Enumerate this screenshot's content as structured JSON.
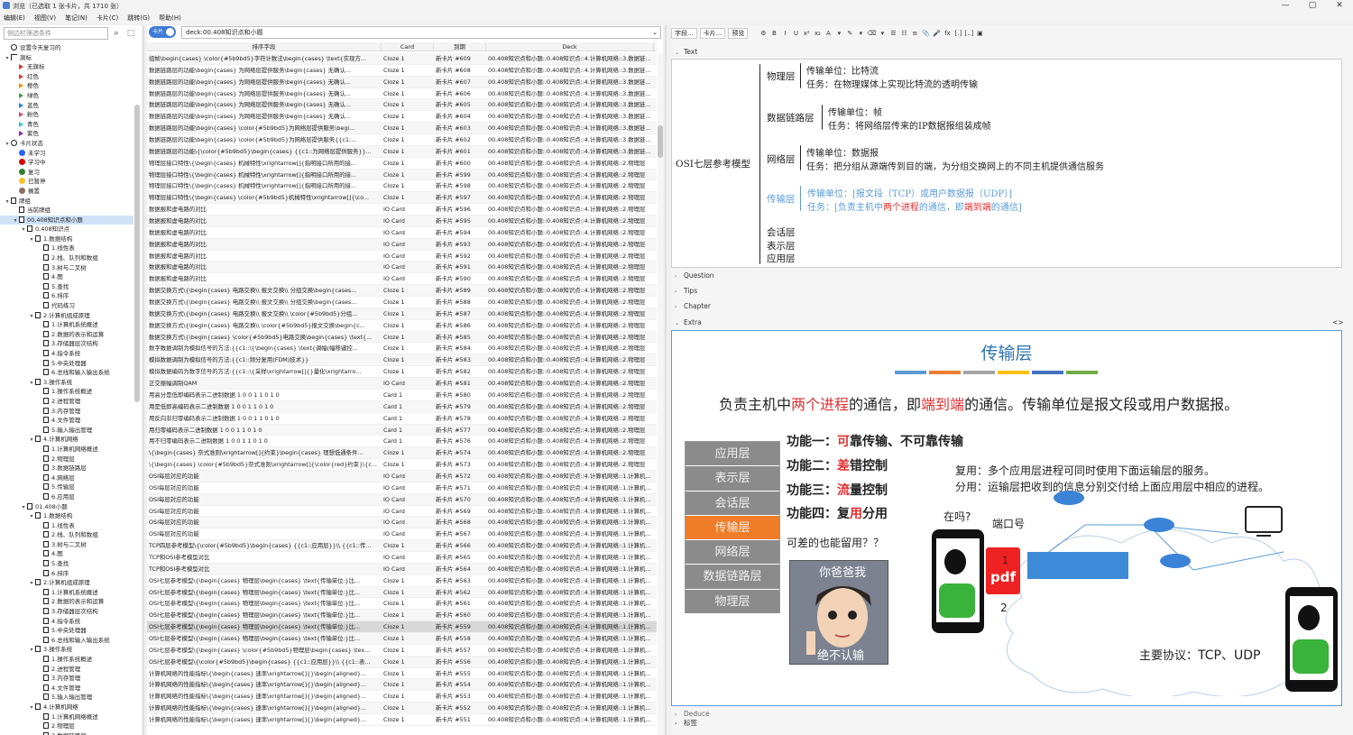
{
  "window": {
    "title": "浏览（已选取 1 张卡片，共 1710 张）",
    "controls": [
      "—",
      "▢",
      "✕"
    ]
  },
  "menu": [
    "编辑(E)",
    "视图(V)",
    "笔记(N)",
    "卡片(C)",
    "跳转(G)",
    "帮助(H)"
  ],
  "sidebar": {
    "search_placeholder": "侧边栏筛选条件",
    "items": [
      {
        "d": 0,
        "a": "",
        "i": "clock",
        "t": "设置今天复习的"
      },
      {
        "d": 0,
        "a": "▾",
        "i": "flag0",
        "t": "旗标"
      },
      {
        "d": 1,
        "a": "",
        "i": "flag",
        "c": "#d33",
        "t": "无旗标"
      },
      {
        "d": 1,
        "a": "",
        "i": "flag",
        "c": "#e53935",
        "t": "红色"
      },
      {
        "d": 1,
        "a": "",
        "i": "flag",
        "c": "#fb8c00",
        "t": "橙色"
      },
      {
        "d": 1,
        "a": "",
        "i": "flag",
        "c": "#43a047",
        "t": "绿色"
      },
      {
        "d": 1,
        "a": "",
        "i": "flag",
        "c": "#1e88e5",
        "t": "蓝色"
      },
      {
        "d": 1,
        "a": "",
        "i": "flag",
        "c": "#ec407a",
        "t": "粉色"
      },
      {
        "d": 1,
        "a": "",
        "i": "flag",
        "c": "#26c6da",
        "t": "青色"
      },
      {
        "d": 1,
        "a": "",
        "i": "flag",
        "c": "#8e24aa",
        "t": "紫色"
      },
      {
        "d": 0,
        "a": "▾",
        "i": "circle",
        "t": "卡片状态"
      },
      {
        "d": 1,
        "a": "",
        "i": "dot",
        "c": "#2962ff",
        "t": "未学习"
      },
      {
        "d": 1,
        "a": "",
        "i": "dot",
        "c": "#d50000",
        "t": "学习中"
      },
      {
        "d": 1,
        "a": "",
        "i": "dot",
        "c": "#2e7d32",
        "t": "复习"
      },
      {
        "d": 1,
        "a": "",
        "i": "dot",
        "c": "#fbc02d",
        "t": "已暂停"
      },
      {
        "d": 1,
        "a": "",
        "i": "dot",
        "c": "#8d6e63",
        "t": "搁置"
      },
      {
        "d": 0,
        "a": "▾",
        "i": "deck",
        "t": "牌组"
      },
      {
        "d": 1,
        "a": "",
        "i": "deck",
        "t": "当前牌组"
      },
      {
        "d": 1,
        "a": "▾",
        "i": "deck",
        "t": "00.408知识点和小题",
        "sel": true
      },
      {
        "d": 2,
        "a": "▾",
        "i": "deck",
        "t": "0.408知识点"
      },
      {
        "d": 3,
        "a": "▾",
        "i": "deck",
        "t": "1.数据结构"
      },
      {
        "d": 4,
        "a": "",
        "i": "deck",
        "t": "1.线性表"
      },
      {
        "d": 4,
        "a": "",
        "i": "deck",
        "t": "2.栈、队列和数组"
      },
      {
        "d": 4,
        "a": "",
        "i": "deck",
        "t": "3.树与二叉树"
      },
      {
        "d": 4,
        "a": "",
        "i": "deck",
        "t": "4.图"
      },
      {
        "d": 4,
        "a": "",
        "i": "deck",
        "t": "5.查找"
      },
      {
        "d": 4,
        "a": "",
        "i": "deck",
        "t": "6.排序"
      },
      {
        "d": 4,
        "a": "",
        "i": "deck",
        "t": "代码练习"
      },
      {
        "d": 3,
        "a": "▾",
        "i": "deck",
        "t": "2.计算机组成原理"
      },
      {
        "d": 4,
        "a": "",
        "i": "deck",
        "t": "1.计算机系统概述"
      },
      {
        "d": 4,
        "a": "",
        "i": "deck",
        "t": "2.数据的表示和运算"
      },
      {
        "d": 4,
        "a": "",
        "i": "deck",
        "t": "3.存储器层次结构"
      },
      {
        "d": 4,
        "a": "",
        "i": "deck",
        "t": "4.指令系统"
      },
      {
        "d": 4,
        "a": "",
        "i": "deck",
        "t": "5.中央处理器"
      },
      {
        "d": 4,
        "a": "",
        "i": "deck",
        "t": "6.总线和输入输出系统"
      },
      {
        "d": 3,
        "a": "▾",
        "i": "deck",
        "t": "3.操作系统"
      },
      {
        "d": 4,
        "a": "",
        "i": "deck",
        "t": "1.操作系统概述"
      },
      {
        "d": 4,
        "a": "",
        "i": "deck",
        "t": "2.进程管理"
      },
      {
        "d": 4,
        "a": "",
        "i": "deck",
        "t": "3.内存管理"
      },
      {
        "d": 4,
        "a": "",
        "i": "deck",
        "t": "4.文件管理"
      },
      {
        "d": 4,
        "a": "",
        "i": "deck",
        "t": "5.输入输出管理"
      },
      {
        "d": 3,
        "a": "▾",
        "i": "deck",
        "t": "4.计算机网络"
      },
      {
        "d": 4,
        "a": "",
        "i": "deck",
        "t": "1.计算机网络概述"
      },
      {
        "d": 4,
        "a": "",
        "i": "deck",
        "t": "2.物理层"
      },
      {
        "d": 4,
        "a": "",
        "i": "deck",
        "t": "3.数据链路层"
      },
      {
        "d": 4,
        "a": "",
        "i": "deck",
        "t": "4.网络层"
      },
      {
        "d": 4,
        "a": "",
        "i": "deck",
        "t": "5.传输层"
      },
      {
        "d": 4,
        "a": "",
        "i": "deck",
        "t": "6.应用层"
      },
      {
        "d": 2,
        "a": "▾",
        "i": "deck",
        "t": "01.408小题"
      },
      {
        "d": 3,
        "a": "▾",
        "i": "deck",
        "t": "1.数据结构"
      },
      {
        "d": 4,
        "a": "",
        "i": "deck",
        "t": "1.线性表"
      },
      {
        "d": 4,
        "a": "",
        "i": "deck",
        "t": "2.栈、队列和数组"
      },
      {
        "d": 4,
        "a": "",
        "i": "deck",
        "t": "3.树与二叉树"
      },
      {
        "d": 4,
        "a": "",
        "i": "deck",
        "t": "4.图"
      },
      {
        "d": 4,
        "a": "",
        "i": "deck",
        "t": "5.查找"
      },
      {
        "d": 4,
        "a": "",
        "i": "deck",
        "t": "6.排序"
      },
      {
        "d": 3,
        "a": "▾",
        "i": "deck",
        "t": "2.计算机组成原理"
      },
      {
        "d": 4,
        "a": "",
        "i": "deck",
        "t": "1.计算机系统概述"
      },
      {
        "d": 4,
        "a": "",
        "i": "deck",
        "t": "2.数据的表示和运算"
      },
      {
        "d": 4,
        "a": "",
        "i": "deck",
        "t": "3.存储器层次结构"
      },
      {
        "d": 4,
        "a": "",
        "i": "deck",
        "t": "4.指令系统"
      },
      {
        "d": 4,
        "a": "",
        "i": "deck",
        "t": "5.中央处理器"
      },
      {
        "d": 4,
        "a": "",
        "i": "deck",
        "t": "6.总线和输入输出系统"
      },
      {
        "d": 3,
        "a": "▾",
        "i": "deck",
        "t": "3.操作系统"
      },
      {
        "d": 4,
        "a": "",
        "i": "deck",
        "t": "1.操作系统概述"
      },
      {
        "d": 4,
        "a": "",
        "i": "deck",
        "t": "2.进程管理"
      },
      {
        "d": 4,
        "a": "",
        "i": "deck",
        "t": "3.内存管理"
      },
      {
        "d": 4,
        "a": "",
        "i": "deck",
        "t": "4.文件管理"
      },
      {
        "d": 4,
        "a": "",
        "i": "deck",
        "t": "5.输入输出管理"
      },
      {
        "d": 3,
        "a": "▾",
        "i": "deck",
        "t": "4.计算机网络"
      },
      {
        "d": 4,
        "a": "",
        "i": "deck",
        "t": "1.计算机网络概述"
      },
      {
        "d": 4,
        "a": "",
        "i": "deck",
        "t": "2.物理层"
      },
      {
        "d": 4,
        "a": "",
        "i": "deck",
        "t": "3.数据链路层"
      }
    ]
  },
  "browser": {
    "toggle_label": "卡片",
    "search_value": "deck:00.408知识点和小题",
    "columns": [
      "排序字段",
      "Card",
      "到期",
      "Deck"
    ],
    "selected_index": 49,
    "rows": [
      [
        "组帧\\begin{cases} \\color{#5b9bd5}字符计数法\\begin{cases} \\text{实现方...",
        "Cloze 1",
        "新卡片 #609",
        "00.408知识点和小题::0.408知识点::4.计算机网络::3.数据链..."
      ],
      [
        "数据链路层的功能\\begin{cases} 为网络层提供服务\\begin{cases} 无确认...",
        "Cloze 1",
        "新卡片 #608",
        "00.408知识点和小题::0.408知识点::4.计算机网络::3.数据链..."
      ],
      [
        "数据链路层的功能\\begin{cases} 为网络层提供服务\\begin{cases} 无确认...",
        "Cloze 1",
        "新卡片 #607",
        "00.408知识点和小题::0.408知识点::4.计算机网络::3.数据链..."
      ],
      [
        "数据链路层的功能\\begin{cases} 为网络层提供服务\\begin{cases} 无确认...",
        "Cloze 1",
        "新卡片 #606",
        "00.408知识点和小题::0.408知识点::4.计算机网络::3.数据链..."
      ],
      [
        "数据链路层的功能\\begin{cases} 为网络层提供服务\\begin{cases} 无确认...",
        "Cloze 1",
        "新卡片 #605",
        "00.408知识点和小题::0.408知识点::4.计算机网络::3.数据链..."
      ],
      [
        "数据链路层的功能\\begin{cases} 为网络层提供服务\\begin{cases} 无确认...",
        "Cloze 1",
        "新卡片 #604",
        "00.408知识点和小题::0.408知识点::4.计算机网络::3.数据链..."
      ],
      [
        "数据链路层的功能\\begin{cases} \\color{#5b9bd5}为网络层提供服务\\begi...",
        "Cloze 1",
        "新卡片 #603",
        "00.408知识点和小题::0.408知识点::4.计算机网络::3.数据链..."
      ],
      [
        "数据链路层的功能\\begin{cases} \\color{#5b9bd5}为网络层提供服务{{c1:...",
        "Cloze 1",
        "新卡片 #602",
        "00.408知识点和小题::0.408知识点::4.计算机网络::3.数据链..."
      ],
      [
        "数据链路层的功能\\{\\color{#5b9bd5}\\begin{cases} {{c1::为网络层提供服务}}...",
        "Cloze 1",
        "新卡片 #601",
        "00.408知识点和小题::0.408知识点::4.计算机网络::3.数据链..."
      ],
      [
        "物理层接口特性\\{\\begin{cases} 机械特性\\xrightarrow[]{指明接口所用的接...",
        "Cloze 1",
        "新卡片 #600",
        "00.408知识点和小题::0.408知识点::4.计算机网络::2.物理层"
      ],
      [
        "物理层接口特性\\{\\begin{cases} 机械特性\\xrightarrow[]{指明接口所用的接...",
        "Cloze 1",
        "新卡片 #599",
        "00.408知识点和小题::0.408知识点::4.计算机网络::2.物理层"
      ],
      [
        "物理层接口特性\\{\\begin{cases} 机械特性\\xrightarrow[]{指明接口所用的接...",
        "Cloze 1",
        "新卡片 #598",
        "00.408知识点和小题::0.408知识点::4.计算机网络::2.物理层"
      ],
      [
        "物理层接口特性\\{\\begin{cases} \\color{#5b9bd5}机械特性\\xrightarrow[]{\\co...",
        "Cloze 1",
        "新卡片 #597",
        "00.408知识点和小题::0.408知识点::4.计算机网络::2.物理层"
      ],
      [
        "数据报和虚电路的对比",
        "IO Card",
        "新卡片 #596",
        "00.408知识点和小题::0.408知识点::4.计算机网络::2.物理层"
      ],
      [
        "数据报和虚电路的对比",
        "IO Card",
        "新卡片 #595",
        "00.408知识点和小题::0.408知识点::4.计算机网络::2.物理层"
      ],
      [
        "数据报和虚电路的对比",
        "IO Card",
        "新卡片 #594",
        "00.408知识点和小题::0.408知识点::4.计算机网络::2.物理层"
      ],
      [
        "数据报和虚电路的对比",
        "IO Card",
        "新卡片 #593",
        "00.408知识点和小题::0.408知识点::4.计算机网络::2.物理层"
      ],
      [
        "数据报和虚电路的对比",
        "IO Card",
        "新卡片 #592",
        "00.408知识点和小题::0.408知识点::4.计算机网络::2.物理层"
      ],
      [
        "数据报和虚电路的对比",
        "IO Card",
        "新卡片 #591",
        "00.408知识点和小题::0.408知识点::4.计算机网络::2.物理层"
      ],
      [
        "数据报和虚电路的对比",
        "IO Card",
        "新卡片 #590",
        "00.408知识点和小题::0.408知识点::4.计算机网络::2.物理层"
      ],
      [
        "数据交换方式\\{\\begin{cases} 电路交换\\\\ 报文交换\\\\ 分组交换\\begin{cases...",
        "Cloze 1",
        "新卡片 #589",
        "00.408知识点和小题::0.408知识点::4.计算机网络::2.物理层"
      ],
      [
        "数据交换方式\\{\\begin{cases} 电路交换\\\\ 报文交换\\\\ 分组交换\\begin{cases...",
        "Cloze 1",
        "新卡片 #588",
        "00.408知识点和小题::0.408知识点::4.计算机网络::2.物理层"
      ],
      [
        "数据交换方式\\{\\begin{cases} 电路交换\\\\ 报文交换\\\\ \\color{#5b9bd5}分组...",
        "Cloze 1",
        "新卡片 #587",
        "00.408知识点和小题::0.408知识点::4.计算机网络::2.物理层"
      ],
      [
        "数据交换方式\\{\\begin{cases} 电路交换\\\\ \\color{#5b9bd5}报文交换\\begin{c...",
        "Cloze 1",
        "新卡片 #586",
        "00.408知识点和小题::0.408知识点::4.计算机网络::2.物理层"
      ],
      [
        "数据交换方式\\{\\begin{cases} \\color{#5b9bd5}电路交换\\begin{cases} \\text{...",
        "Cloze 1",
        "新卡片 #585",
        "00.408知识点和小题::0.408知识点::4.计算机网络::2.物理层"
      ],
      [
        "数字数据调制为模拟信号的方法:{{c1::\\{\\begin{cases} \\text{调幅(幅移键控...",
        "Cloze 1",
        "新卡片 #584",
        "00.408知识点和小题::0.408知识点::4.计算机网络::2.物理层"
      ],
      [
        "模拟数据调制为模拟信号的方法:{{c1::频分复用(FDM)技术}}",
        "Cloze 1",
        "新卡片 #583",
        "00.408知识点和小题::0.408知识点::4.计算机网络::2.物理层"
      ],
      [
        "模拟数据编码为数字信号的方法:{{c1::\\{采样\\xrightarrow[]{}量化\\xrightarro...",
        "Cloze 1",
        "新卡片 #582",
        "00.408知识点和小题::0.408知识点::4.计算机网络::2.物理层"
      ],
      [
        "正交振幅调制QAM",
        "IO Card",
        "新卡片 #581",
        "00.408知识点和小题::0.408知识点::4.计算机网络::2.物理层"
      ],
      [
        "用高分是低即编码表示二进制数据 1 0 0 1 1 0 1 0",
        "Card 1",
        "新卡片 #580",
        "00.408知识点和小题::0.408知识点::4.计算机网络::2.物理层"
      ],
      [
        "用是低即高编码表示二进制数据 1 0 0 1 1 0 1 0",
        "Card 1",
        "新卡片 #579",
        "00.408知识点和小题::0.408知识点::4.计算机网络::2.物理层"
      ],
      [
        "用反向非归零编码表示二进制数据 1 0 0 1 1 0 1 0",
        "Card 1",
        "新卡片 #578",
        "00.408知识点和小题::0.408知识点::4.计算机网络::2.物理层"
      ],
      [
        "用归零编码表示二进制数据 1 0 0 1 1 0 1 0",
        "Card 1",
        "新卡片 #577",
        "00.408知识点和小题::0.408知识点::4.计算机网络::2.物理层"
      ],
      [
        "用不归零编码表示二进制数据 1 0 0 1 1 0 1 0",
        "Card 1",
        "新卡片 #576",
        "00.408知识点和小题::0.408知识点::4.计算机网络::2.物理层"
      ],
      [
        "\\{\\begin{cases} 奈式准则\\xrightarrow[]{约束}\\begin{cases} 理想低通条件...",
        "Cloze 1",
        "新卡片 #574",
        "00.408知识点和小题::0.408知识点::4.计算机网络::2.物理层"
      ],
      [
        "\\{\\begin{cases} \\color{#5b9bd5}奈式准则\\xrightarrow[]{\\color{red}约束}\\{c...",
        "Cloze 1",
        "新卡片 #573",
        "00.408知识点和小题::0.408知识点::4.计算机网络::2.物理层"
      ],
      [
        "OSI每层対应的功能",
        "IO Card",
        "新卡片 #572",
        "00.408知识点和小题::0.408知识点::4.计算机网络::1.计算机..."
      ],
      [
        "OSI每层対应的功能",
        "IO Card",
        "新卡片 #571",
        "00.408知识点和小题::0.408知识点::4.计算机网络::1.计算机..."
      ],
      [
        "OSI每层対应的功能",
        "IO Card",
        "新卡片 #570",
        "00.408知识点和小题::0.408知识点::4.计算机网络::1.计算机..."
      ],
      [
        "OSI每层対应的功能",
        "IO Card",
        "新卡片 #569",
        "00.408知识点和小题::0.408知识点::4.计算机网络::1.计算机..."
      ],
      [
        "OSI每层対应的功能",
        "IO Card",
        "新卡片 #568",
        "00.408知识点和小题::0.408知识点::4.计算机网络::1.计算机..."
      ],
      [
        "OSI每层対应的功能",
        "IO Card",
        "新卡片 #567",
        "00.408知识点和小题::0.408知识点::4.计算机网络::1.计算机..."
      ],
      [
        "TCP四层参考模型\\{\\color{#5b9bd5}\\begin{cases} {{c1::应用层}}\\\\ {{c1::传...",
        "Cloze 1",
        "新卡片 #566",
        "00.408知识点和小题::0.408知识点::4.计算机网络::1.计算机..."
      ],
      [
        "TCP和OSI参考模型对比",
        "IO Card",
        "新卡片 #565",
        "00.408知识点和小题::0.408知识点::4.计算机网络::1.计算机..."
      ],
      [
        "TCP和OSI参考模型对比",
        "IO Card",
        "新卡片 #564",
        "00.408知识点和小题::0.408知识点::4.计算机网络::1.计算机..."
      ],
      [
        "OSI七层参考模型\\{\\begin{cases} 物理层\\begin{cases} \\text{传输单位:}比...",
        "Cloze 1",
        "新卡片 #563",
        "00.408知识点和小题::0.408知识点::4.计算机网络::1.计算机..."
      ],
      [
        "OSI七层参考模型\\{\\begin{cases} 物理层\\begin{cases} \\text{传输单位:}比...",
        "Cloze 1",
        "新卡片 #562",
        "00.408知识点和小题::0.408知识点::4.计算机网络::1.计算机..."
      ],
      [
        "OSI七层参考模型\\{\\begin{cases} 物理层\\begin{cases} \\text{传输单位:}比...",
        "Cloze 1",
        "新卡片 #561",
        "00.408知识点和小题::0.408知识点::4.计算机网络::1.计算机..."
      ],
      [
        "OSI七层参考模型\\{\\begin{cases} 物理层\\begin{cases} \\text{传输单位:}比...",
        "Cloze 1",
        "新卡片 #560",
        "00.408知识点和小题::0.408知识点::4.计算机网络::1.计算机..."
      ],
      [
        "OSI七层参考模型\\{\\begin{cases} 物理层\\begin{cases} \\text{传输单位:}比...",
        "Cloze 1",
        "新卡片 #559",
        "00.408知识点和小题::0.408知识点::4.计算机网络::1.计算机..."
      ],
      [
        "OSI七层参考模型\\{\\begin{cases} 物理层\\begin{cases} \\text{传输单位:}比...",
        "Cloze 1",
        "新卡片 #558",
        "00.408知识点和小题::0.408知识点::4.计算机网络::1.计算机..."
      ],
      [
        "OSI七层参考模型\\{\\begin{cases} \\color{#5b9bd5}物理层\\begin{cases} \\tex...",
        "Cloze 1",
        "新卡片 #557",
        "00.408知识点和小题::0.408知识点::4.计算机网络::1.计算机..."
      ],
      [
        "OSI七层参考模型\\{\\color{#5b9bd5}\\begin{cases} {{c1::应用层}}\\\\ {{c1::表...",
        "Cloze 1",
        "新卡片 #556",
        "00.408知识点和小题::0.408知识点::4.计算机网络::1.计算机..."
      ],
      [
        "计算机网络的性能指标\\{\\begin{cases} 速率\\xrightarrow[]{}\\begin{aligned}...",
        "Cloze 1",
        "新卡片 #555",
        "00.408知识点和小题::0.408知识点::4.计算机网络::1.计算机..."
      ],
      [
        "计算机网络的性能指标\\{\\begin{cases} 速率\\xrightarrow[]{}\\begin{aligned}...",
        "Cloze 1",
        "新卡片 #554",
        "00.408知识点和小题::0.408知识点::4.计算机网络::1.计算机..."
      ],
      [
        "计算机网络的性能指标\\{\\begin{cases} 速率\\xrightarrow[]{}\\begin{aligned}...",
        "Cloze 1",
        "新卡片 #553",
        "00.408知识点和小题::0.408知识点::4.计算机网络::1.计算机..."
      ],
      [
        "计算机网络的性能指标\\{\\begin{cases} 速率\\xrightarrow[]{}\\begin{aligned}...",
        "Cloze 1",
        "新卡片 #552",
        "00.408知识点和小题::0.408知识点::4.计算机网络::1.计算机..."
      ],
      [
        "计算机网络的性能指标\\{\\begin{cases} 速率\\xrightarrow[]{}\\begin{aligned}...",
        "Cloze 1",
        "新卡片 #551",
        "00.408知识点和小题::0.408知识点::4.计算机网络::1.计算机..."
      ]
    ]
  },
  "editor": {
    "toolbar_buttons": [
      "字段...",
      "卡片...",
      "预览"
    ],
    "toolbar_icons": [
      "⚙",
      "B",
      "I",
      "U",
      "x²",
      "x₂",
      "A",
      "▾",
      "✎",
      "▾",
      "⌫",
      "▾",
      "☰",
      "☷",
      "≡",
      "📎",
      "🎤",
      "fx",
      "[.]",
      "[..]",
      "▣"
    ],
    "fields": {
      "text": "Text",
      "question": "Question",
      "tips": "Tips",
      "chapter": "Chapter",
      "extra": "Extra",
      "deduce": "Deduce",
      "tags": "标签"
    },
    "text_content": {
      "root": "OSI七层参考模型",
      "physical": {
        "name": "物理层",
        "unit": "传输单位：比特流",
        "task": "任务：在物理媒体上实现比特流的透明传输"
      },
      "datalink": {
        "name": "数据链路层",
        "unit": "传输单位：帧",
        "task": "任务：将网络层传来的IP数据报组装成帧"
      },
      "network": {
        "name": "网络层",
        "unit": "传输单位：数据报",
        "task": "任务：把分组从源端传到目的端，为分组交换网上的不同主机提供通信服务"
      },
      "transport": {
        "name": "传输层",
        "unit_pre": "传输单位：",
        "unit_val": "[报文段（TCP）或用户数据报（UDP）]",
        "task_pre": "任务：",
        "task_a": "[负责主机中",
        "task_b": "两个进程",
        "task_c": "的通信，即",
        "task_d": "端到端",
        "task_e": "的通信]"
      },
      "session": "会话层",
      "presentation": "表示层",
      "application": "应用层"
    },
    "extra_content": {
      "title": "传输层",
      "strip_colors": [
        "#5b9bd5",
        "#ed7d31",
        "#a5a5a5",
        "#ffc000",
        "#4472c4",
        "#70ad47"
      ],
      "headline_a": "负责主机中",
      "headline_b": "两个进程",
      "headline_c": "的通信，即",
      "headline_d": "端到端",
      "headline_e": "的通信。传输单位是报文段或用户数据报。",
      "layers": [
        "应用层",
        "表示层",
        "会话层",
        "传输层",
        "网络层",
        "数据链路层",
        "物理层"
      ],
      "active_layer": 3,
      "f1_pre": "功能一：",
      "f1_red": "可",
      "f1_post": "靠传输、不可靠传输",
      "f2_pre": "功能二：",
      "f2_red": "差",
      "f2_post": "错控制",
      "f3_pre": "功能三：",
      "f3_red": "流",
      "f3_post": "量控制",
      "f4_pre": "功能四：",
      "f4_red": "复",
      "f4_mid": "用",
      "f4_red2": "",
      "f4_post": "分用",
      "mux": "复用：多个应用层进程可同时使用下面运输层的服务。",
      "demux": "分用：运输层把收到的信息分别交付给上面应用层中相应的进程。",
      "question": "可差的也能留用？？",
      "online": "在吗?",
      "port": "端口号",
      "pdf": "pdf",
      "num1": "1",
      "num2": "2",
      "meme_top": "你爸爸我",
      "meme_bottom": "绝不认输",
      "protocols_label": "主要协议：",
      "protocols": "TCP、UDP"
    }
  }
}
